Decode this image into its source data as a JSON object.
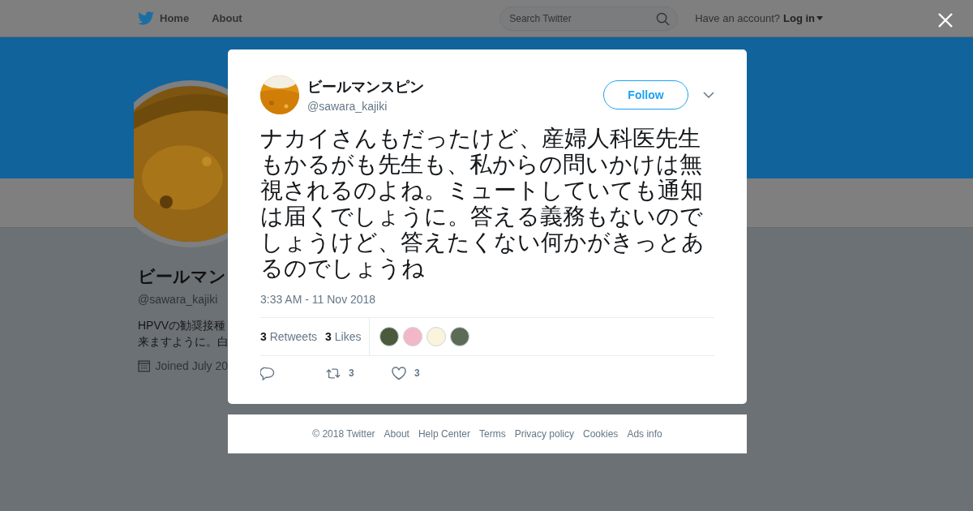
{
  "nav": {
    "items": [
      {
        "label": "Home"
      },
      {
        "label": "About"
      }
    ],
    "search": {
      "placeholder": "Search Twitter"
    },
    "account_prompt": "Have an account?",
    "login": "Log in"
  },
  "profile": {
    "name": "ビールマン",
    "handle": "@sawara_kajiki",
    "bio": [
      "HPVVの勧奨接種",
      "来ますように。白"
    ],
    "joined": "Joined July 20"
  },
  "tweet": {
    "name": "ビールマンスピン",
    "handle": "@sawara_kajiki",
    "follow": "Follow",
    "text": "ナカイさんもだったけど、産婦人科医先生もかるがも先生も、私からの問いかけは無視されるのよね。ミュートしていても通知は届くでしょうに。答える義務もないのでしょうけど、答えたくない何かがきっとあるのでしょうね",
    "time": "3:33 AM - 11 Nov 2018",
    "retweets": {
      "count": "3",
      "label": "Retweets"
    },
    "likes": {
      "count": "3",
      "label": "Likes"
    },
    "likers": [
      {
        "color": "#4a5a3a"
      },
      {
        "color": "#f2b8c8"
      },
      {
        "color": "#fbf3dc"
      },
      {
        "color": "#5b6b55"
      }
    ],
    "actions": [
      {
        "kind": "reply"
      },
      {
        "kind": "retweet",
        "count": "3"
      },
      {
        "kind": "like",
        "count": "3"
      }
    ]
  },
  "footer": [
    "© 2018 Twitter",
    "About",
    "Help Center",
    "Terms",
    "Privacy policy",
    "Cookies",
    "Ads info"
  ]
}
